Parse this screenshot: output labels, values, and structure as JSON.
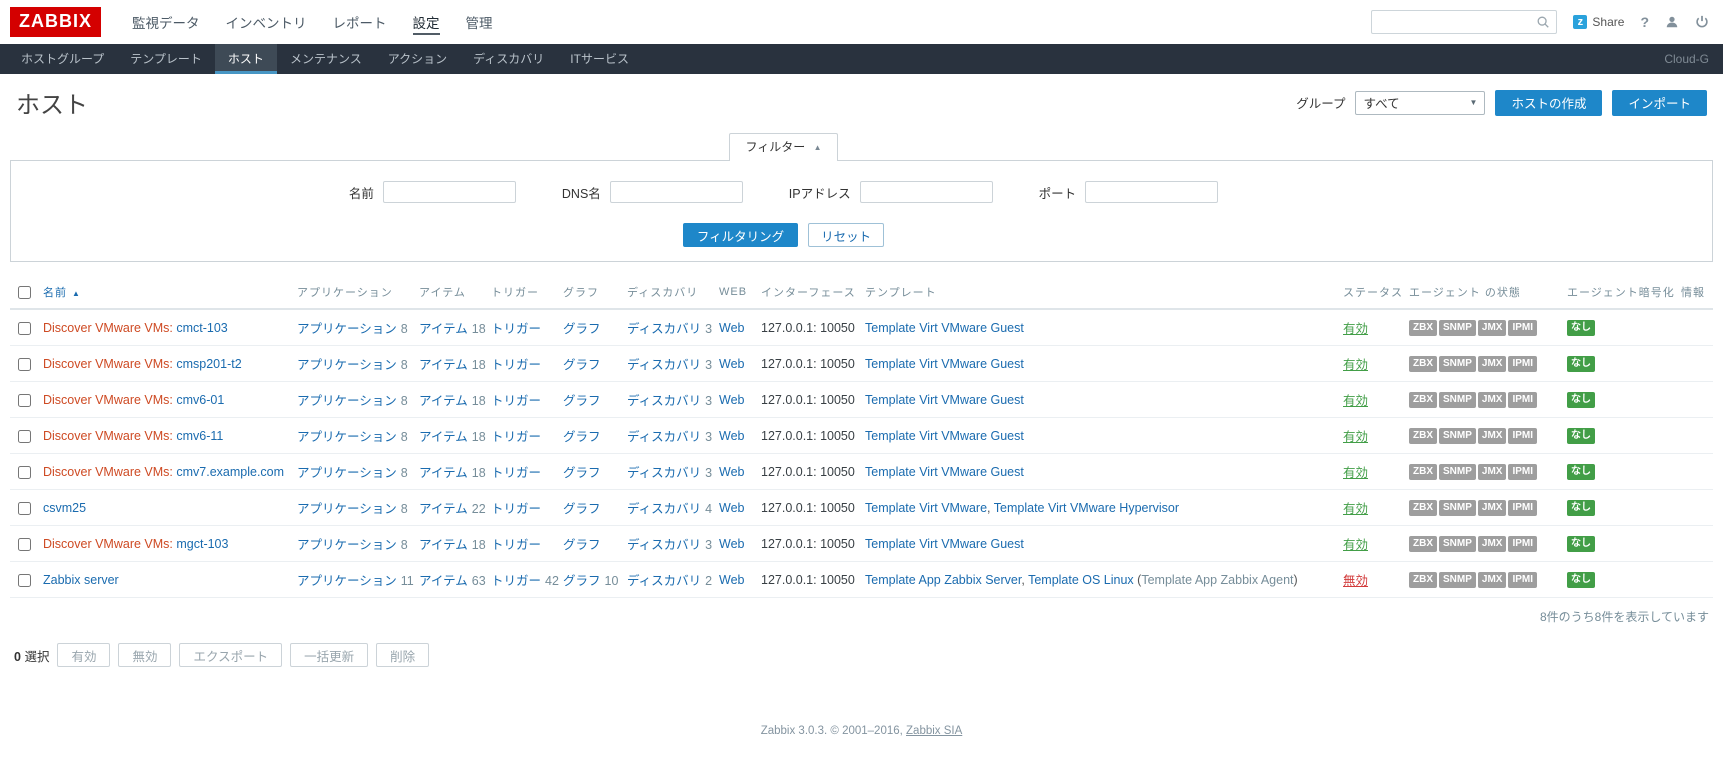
{
  "colors": {
    "brand_red": "#d40000",
    "link_blue": "#1a6baf",
    "button_blue": "#1e87c9",
    "green": "#429e47",
    "red": "#d23b3b",
    "discovered_orange": "#ce4a23",
    "navbar_bg": "#29323e",
    "navbar_active_bg": "#3e4a56",
    "navbar_underline": "#4796c4",
    "badge_gray": "#9e9e9e",
    "table_header_gray": "#768d99"
  },
  "icons": {
    "sort_asc": "▲",
    "filter_collapse": "▲",
    "select_arrow": "▼",
    "share_z": "z",
    "help": "?"
  },
  "header": {
    "logo": "ZABBIX",
    "menu": [
      "監視データ",
      "インベントリ",
      "レポート",
      "設定",
      "管理"
    ],
    "active_menu": "設定",
    "search_placeholder": "",
    "share_label": "Share"
  },
  "subnav": {
    "items": [
      "ホストグループ",
      "テンプレート",
      "ホスト",
      "メンテナンス",
      "アクション",
      "ディスカバリ",
      "ITサービス"
    ],
    "active_item": "ホスト",
    "right_label": "Cloud-G"
  },
  "page": {
    "title": "ホスト",
    "group_label": "グループ",
    "group_value": "すべて",
    "create_host_button": "ホストの作成",
    "import_button": "インポート"
  },
  "filter": {
    "tab_label": "フィルター",
    "fields": [
      {
        "key": "name",
        "label": "名前",
        "value": ""
      },
      {
        "key": "dns",
        "label": "DNS名",
        "value": ""
      },
      {
        "key": "ip",
        "label": "IPアドレス",
        "value": ""
      },
      {
        "key": "port",
        "label": "ポート",
        "value": ""
      }
    ],
    "apply_button": "フィルタリング",
    "reset_button": "リセット"
  },
  "table": {
    "columns": [
      {
        "label": "名前",
        "sortable": true
      },
      {
        "label": "アプリケーション"
      },
      {
        "label": "アイテム"
      },
      {
        "label": "トリガー"
      },
      {
        "label": "グラフ"
      },
      {
        "label": "ディスカバリ"
      },
      {
        "label": "WEB"
      },
      {
        "label": "インターフェース"
      },
      {
        "label": "テンプレート"
      },
      {
        "label": "ステータス"
      },
      {
        "label": "エージェント の状態"
      },
      {
        "label": "エージェント暗号化"
      },
      {
        "label": "情報"
      }
    ],
    "cell_labels": {
      "applications": "アプリケーション",
      "items": "アイテム",
      "triggers": "トリガー",
      "graphs": "グラフ",
      "discovery": "ディスカバリ",
      "web": "Web"
    },
    "rows": [
      {
        "prefix": "Discover VMware VMs",
        "name": "cmct-103",
        "applications": 8,
        "items": 18,
        "triggers": null,
        "graphs": null,
        "discovery": 3,
        "web": null,
        "interface": "127.0.0.1: 10050",
        "templates": [
          {
            "text": "Template Virt VMware Guest",
            "type": "link"
          }
        ],
        "status": "有効",
        "status_type": "enabled",
        "agents": [
          "ZBX",
          "SNMP",
          "JMX",
          "IPMI"
        ],
        "encryption": "なし"
      },
      {
        "prefix": "Discover VMware VMs",
        "name": "cmsp201-t2",
        "applications": 8,
        "items": 18,
        "triggers": null,
        "graphs": null,
        "discovery": 3,
        "web": null,
        "interface": "127.0.0.1: 10050",
        "templates": [
          {
            "text": "Template Virt VMware Guest",
            "type": "link"
          }
        ],
        "status": "有効",
        "status_type": "enabled",
        "agents": [
          "ZBX",
          "SNMP",
          "JMX",
          "IPMI"
        ],
        "encryption": "なし"
      },
      {
        "prefix": "Discover VMware VMs",
        "name": "cmv6-01",
        "applications": 8,
        "items": 18,
        "triggers": null,
        "graphs": null,
        "discovery": 3,
        "web": null,
        "interface": "127.0.0.1: 10050",
        "templates": [
          {
            "text": "Template Virt VMware Guest",
            "type": "link"
          }
        ],
        "status": "有効",
        "status_type": "enabled",
        "agents": [
          "ZBX",
          "SNMP",
          "JMX",
          "IPMI"
        ],
        "encryption": "なし"
      },
      {
        "prefix": "Discover VMware VMs",
        "name": "cmv6-11",
        "applications": 8,
        "items": 18,
        "triggers": null,
        "graphs": null,
        "discovery": 3,
        "web": null,
        "interface": "127.0.0.1: 10050",
        "templates": [
          {
            "text": "Template Virt VMware Guest",
            "type": "link"
          }
        ],
        "status": "有効",
        "status_type": "enabled",
        "agents": [
          "ZBX",
          "SNMP",
          "JMX",
          "IPMI"
        ],
        "encryption": "なし"
      },
      {
        "prefix": "Discover VMware VMs",
        "name": "cmv7.example.com",
        "applications": 8,
        "items": 18,
        "triggers": null,
        "graphs": null,
        "discovery": 3,
        "web": null,
        "interface": "127.0.0.1: 10050",
        "templates": [
          {
            "text": "Template Virt VMware Guest",
            "type": "link"
          }
        ],
        "status": "有効",
        "status_type": "enabled",
        "agents": [
          "ZBX",
          "SNMP",
          "JMX",
          "IPMI"
        ],
        "encryption": "なし"
      },
      {
        "prefix": null,
        "name": "csvm25",
        "applications": 8,
        "items": 22,
        "triggers": null,
        "graphs": null,
        "discovery": 4,
        "web": null,
        "interface": "127.0.0.1: 10050",
        "templates": [
          {
            "text": "Template Virt VMware",
            "type": "link"
          },
          {
            "text": ", ",
            "type": "text"
          },
          {
            "text": "Template Virt VMware Hypervisor",
            "type": "link"
          }
        ],
        "status": "有効",
        "status_type": "enabled",
        "agents": [
          "ZBX",
          "SNMP",
          "JMX",
          "IPMI"
        ],
        "encryption": "なし"
      },
      {
        "prefix": "Discover VMware VMs",
        "name": "mgct-103",
        "applications": 8,
        "items": 18,
        "triggers": null,
        "graphs": null,
        "discovery": 3,
        "web": null,
        "interface": "127.0.0.1: 10050",
        "templates": [
          {
            "text": "Template Virt VMware Guest",
            "type": "link"
          }
        ],
        "status": "有効",
        "status_type": "enabled",
        "agents": [
          "ZBX",
          "SNMP",
          "JMX",
          "IPMI"
        ],
        "encryption": "なし"
      },
      {
        "prefix": null,
        "name": "Zabbix server",
        "applications": 11,
        "items": 63,
        "triggers": 42,
        "graphs": 10,
        "discovery": 2,
        "web": null,
        "interface": "127.0.0.1: 10050",
        "templates": [
          {
            "text": "Template App Zabbix Server",
            "type": "link"
          },
          {
            "text": ", ",
            "type": "text"
          },
          {
            "text": "Template OS Linux",
            "type": "link"
          },
          {
            "text": " (",
            "type": "text"
          },
          {
            "text": "Template App Zabbix Agent",
            "type": "muted"
          },
          {
            "text": ")",
            "type": "text"
          }
        ],
        "status": "無効",
        "status_type": "disabled",
        "agents": [
          "ZBX",
          "SNMP",
          "JMX",
          "IPMI"
        ],
        "encryption": "なし"
      }
    ],
    "stats": "8件のうち8件を表示しています"
  },
  "action_bar": {
    "selected_count": "0",
    "selected_label": "選択",
    "buttons": [
      {
        "label": "有効",
        "enabled": false
      },
      {
        "label": "無効",
        "enabled": false
      },
      {
        "label": "エクスポート",
        "enabled": false
      },
      {
        "label": "一括更新",
        "enabled": false
      },
      {
        "label": "削除",
        "enabled": false
      }
    ]
  },
  "footer": {
    "text": "Zabbix 3.0.3. © 2001–2016, ",
    "link": "Zabbix SIA"
  }
}
